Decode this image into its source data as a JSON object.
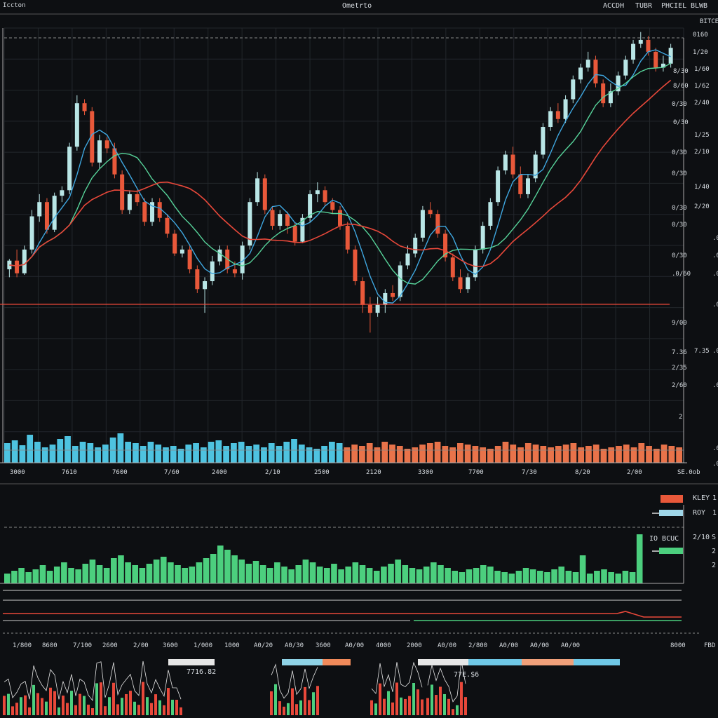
{
  "header": {
    "title": "Ometrto",
    "left_label": "Iccton",
    "right_labels": [
      "ACCDH",
      "TUBR",
      "PHCIEL",
      "BLWB"
    ],
    "sub_right": "BITCE"
  },
  "colors": {
    "background": "#0d0f12",
    "grid": "#23272c",
    "up_candle": "#b9e6e6",
    "down_candle": "#e8583a",
    "ma_fast": "#3fa7e0",
    "ma_mid": "#57d39a",
    "ma_slow": "#e8483a",
    "volume_up": "#4ec3e0",
    "volume_down": "#e8734a",
    "osc": "#4ccf7e"
  },
  "price_axis_labels": [
    "1/20",
    "1/60",
    "1/62",
    "2/40",
    "1/25",
    "2/10",
    "1/40",
    "2/20",
    ".0",
    ".0",
    ".0",
    ".0",
    "7.35",
    ".0",
    ".0",
    "2",
    ".0",
    ".0"
  ],
  "price_markers": [
    "0160",
    "8/30",
    "8/60",
    "0/30",
    "0/30",
    "0/30",
    "0/30",
    "0/30",
    "0/30",
    "0/30",
    ".0/60",
    "9/00",
    "7.36",
    "2/35",
    "2/60"
  ],
  "x_axis_main": [
    "3000",
    "7610",
    "7600",
    "7/60",
    "2400",
    "2/10",
    "2500",
    "2120",
    "3300",
    "7700",
    "7/30",
    "8/20",
    "2/00",
    "SE.0ob"
  ],
  "x_axis_lower": [
    "1/800",
    "8600",
    "7/100",
    "2600",
    "2/00",
    "3600",
    "1/000",
    "1000",
    "A0/20",
    "A0/30",
    "3600",
    "A0/00",
    "4000",
    "2000",
    "A0/00",
    "2/800",
    "A0/00",
    "A0/00",
    "A0/00",
    "8000",
    "FBD"
  ],
  "legend": {
    "items": [
      "KLEY",
      "ROY"
    ],
    "right_values": [
      "1",
      "1"
    ],
    "osc_label": "IO BCUC",
    "osc_value": "2/10",
    "osc_right": [
      "S",
      "2",
      "2"
    ]
  },
  "mini_charts": {
    "left_value": "7716.82",
    "right_value": "77E.$6"
  },
  "chart_data": [
    {
      "type": "candlestick",
      "title": "",
      "series": [
        {
          "name": "",
          "values": [
            [
              385,
              374,
              395,
              372
            ],
            [
              374,
              390,
              395,
              360
            ],
            [
              390,
              360,
              392,
              355
            ],
            [
              360,
              318,
              365,
              310
            ],
            [
              318,
              300,
              325,
              290
            ],
            [
              300,
              335,
              340,
              295
            ],
            [
              335,
              292,
              338,
              288
            ],
            [
              292,
              285,
              300,
              280
            ],
            [
              285,
              230,
              290,
              225
            ],
            [
              230,
              175,
              235,
              165
            ],
            [
              175,
              185,
              190,
              170
            ],
            [
              185,
              250,
              255,
              180
            ],
            [
              250,
              222,
              258,
              215
            ],
            [
              222,
              232,
              238,
              218
            ],
            [
              232,
              265,
              270,
              225
            ],
            [
              265,
              310,
              315,
              260
            ],
            [
              310,
              290,
              315,
              285
            ],
            [
              290,
              300,
              305,
              285
            ],
            [
              300,
              325,
              330,
              295
            ],
            [
              325,
              300,
              330,
              295
            ],
            [
              300,
              320,
              325,
              295
            ],
            [
              320,
              340,
              345,
              315
            ],
            [
              340,
              365,
              368,
              335
            ],
            [
              365,
              360,
              370,
              355
            ],
            [
              360,
              385,
              390,
              355
            ],
            [
              385,
              410,
              415,
              380
            ],
            [
              410,
              400,
              440,
              395
            ],
            [
              400,
              375,
              405,
              368
            ],
            [
              375,
              360,
              380,
              355
            ],
            [
              360,
              385,
              390,
              355
            ],
            [
              385,
              390,
              395,
              375
            ],
            [
              390,
              355,
              398,
              350
            ],
            [
              355,
              300,
              360,
              295
            ],
            [
              300,
              270,
              305,
              262
            ],
            [
              270,
              310,
              315,
              265
            ],
            [
              310,
              330,
              335,
              305
            ],
            [
              330,
              315,
              335,
              310
            ],
            [
              315,
              330,
              340,
              312
            ],
            [
              330,
              350,
              355,
              325
            ],
            [
              350,
              320,
              352,
              315
            ],
            [
              320,
              290,
              325,
              285
            ],
            [
              290,
              285,
              300,
              275
            ],
            [
              285,
              300,
              305,
              280
            ],
            [
              300,
              310,
              315,
              295
            ],
            [
              310,
              330,
              335,
              305
            ],
            [
              330,
              360,
              365,
              325
            ],
            [
              360,
              400,
              405,
              355
            ],
            [
              400,
              430,
              440,
              395
            ],
            [
              430,
              440,
              465,
              420
            ],
            [
              440,
              430,
              445,
              420
            ],
            [
              430,
              415,
              440,
              410
            ],
            [
              415,
              420,
              425,
              405
            ],
            [
              420,
              380,
              425,
              375
            ],
            [
              380,
              365,
              385,
              355
            ],
            [
              365,
              345,
              370,
              340
            ],
            [
              345,
              310,
              350,
              305
            ],
            [
              310,
              315,
              320,
              300
            ],
            [
              315,
              340,
              345,
              310
            ],
            [
              340,
              370,
              375,
              335
            ],
            [
              370,
              395,
              400,
              365
            ],
            [
              395,
              410,
              415,
              385
            ],
            [
              410,
              395,
              415,
              390
            ],
            [
              395,
              360,
              400,
              355
            ],
            [
              360,
              330,
              365,
              325
            ],
            [
              330,
              300,
              335,
              295
            ],
            [
              300,
              260,
              305,
              255
            ],
            [
              260,
              240,
              265,
              235
            ],
            [
              240,
              265,
              270,
              230
            ],
            [
              265,
              290,
              295,
              255
            ],
            [
              290,
              270,
              295,
              265
            ],
            [
              270,
              240,
              275,
              235
            ],
            [
              240,
              205,
              245,
              200
            ],
            [
              205,
              185,
              210,
              180
            ],
            [
              185,
              195,
              200,
              175
            ],
            [
              195,
              170,
              200,
              165
            ],
            [
              170,
              145,
              175,
              140
            ],
            [
              145,
              130,
              150,
              125
            ],
            [
              130,
              120,
              135,
              110
            ],
            [
              120,
              150,
              155,
              115
            ],
            [
              150,
              175,
              180,
              145
            ],
            [
              175,
              160,
              180,
              150
            ],
            [
              160,
              140,
              165,
              135
            ],
            [
              140,
              120,
              145,
              115
            ],
            [
              120,
              100,
              125,
              95
            ],
            [
              100,
              95,
              105,
              85
            ],
            [
              95,
              110,
              115,
              90
            ],
            [
              110,
              130,
              135,
              105
            ],
            [
              130,
              125,
              135,
              115
            ],
            [
              125,
              105,
              130,
              100
            ]
          ]
        }
      ],
      "moving_averages": [
        "MA-fast",
        "MA-mid",
        "MA-slow"
      ]
    },
    {
      "type": "bar",
      "title": "",
      "series": [
        {
          "name": "",
          "values": [
            28,
            32,
            25,
            40,
            30,
            22,
            26,
            34,
            38,
            24,
            30,
            28,
            22,
            26,
            36,
            42,
            30,
            28,
            24,
            30,
            26,
            22,
            24,
            20,
            26,
            28,
            22,
            30,
            32,
            24,
            28,
            30,
            24,
            26,
            22,
            28,
            24,
            30,
            34,
            26,
            22,
            20,
            24,
            30,
            28,
            22,
            26,
            24,
            28,
            22,
            30,
            26,
            24,
            20,
            22,
            26,
            28,
            30,
            24,
            22,
            28,
            26,
            24,
            22,
            20,
            24,
            30,
            26,
            22,
            28,
            26,
            24,
            22,
            24,
            26,
            28,
            22,
            24,
            26,
            20,
            22,
            24,
            26,
            22,
            28,
            24,
            20,
            26,
            24,
            22
          ]
        }
      ]
    },
    {
      "type": "bar",
      "title": "",
      "series": [
        {
          "name": "",
          "values": [
            14,
            18,
            22,
            16,
            20,
            26,
            18,
            24,
            30,
            22,
            20,
            28,
            34,
            26,
            22,
            36,
            40,
            30,
            26,
            22,
            28,
            34,
            38,
            30,
            26,
            22,
            24,
            30,
            36,
            42,
            54,
            48,
            40,
            34,
            28,
            32,
            26,
            22,
            30,
            24,
            20,
            26,
            34,
            30,
            24,
            22,
            28,
            20,
            24,
            30,
            26,
            22,
            18,
            24,
            28,
            34,
            26,
            22,
            20,
            24,
            30,
            26,
            22,
            18,
            16,
            20,
            22,
            26,
            24,
            18,
            16,
            14,
            18,
            22,
            20,
            18,
            16,
            20,
            24,
            18,
            16,
            40,
            14,
            18,
            20,
            16,
            14,
            18,
            16,
            70
          ]
        }
      ]
    }
  ]
}
